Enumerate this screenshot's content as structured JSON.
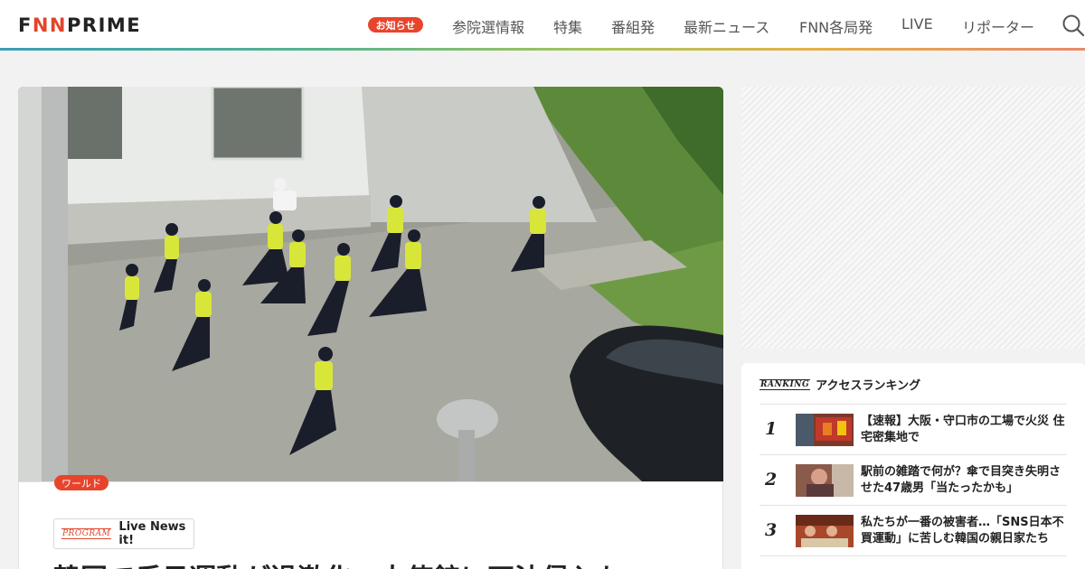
{
  "header": {
    "logo": "FNN PRIME",
    "logo_part1": "F",
    "logo_part2": "NN",
    "logo_part3": " PRIME",
    "badge": "お知らせ",
    "nav": [
      "参院選情報",
      "特集",
      "番組発",
      "最新ニュース",
      "FNN各局発",
      "LIVE",
      "リポーター"
    ]
  },
  "article": {
    "category": "ワールド",
    "program_mark": "PROGRAM",
    "program_name": "Live News it!",
    "headline": "韓国で反日運動が過激化　大使館に不法侵入も"
  },
  "ranking": {
    "mark": "RANKING",
    "title": "アクセスランキング",
    "items": [
      {
        "rank": "1",
        "title": "【速報】大阪・守口市の工場で火災 住宅密集地で"
      },
      {
        "rank": "2",
        "title": "駅前の雑踏で何が？傘で目突き失明させた47歳男「当たったかも」"
      },
      {
        "rank": "3",
        "title": "私たちが一番の被害者…「SNS日本不買運動」に苦しむ韓国の親日家たち"
      }
    ]
  },
  "colors": {
    "accent": "#e8442c",
    "text": "#222222",
    "nav_text": "#555555",
    "background": "#f2f2f2"
  }
}
